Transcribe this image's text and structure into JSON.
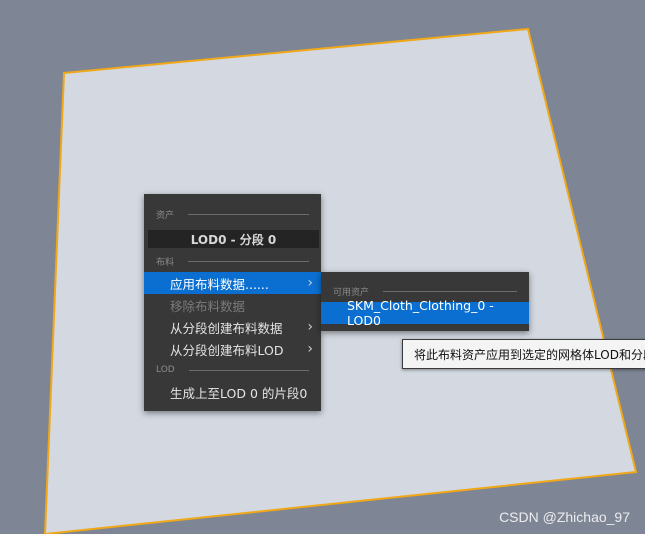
{
  "scene": {
    "background_color": "#7e8594",
    "plane_color": "#d3d8e1",
    "selection_outline_color": "#f0a818"
  },
  "context_menu": {
    "asset_section_header": "资产",
    "title": "LOD0 - 分段 0",
    "cloth_section_header": "布料",
    "items": [
      {
        "label": "应用布料数据......",
        "state": "active",
        "has_submenu": true
      },
      {
        "label": "移除布料数据",
        "state": "disabled",
        "has_submenu": false
      },
      {
        "label": "从分段创建布料数据",
        "state": "normal",
        "has_submenu": true
      },
      {
        "label": "从分段创建布料LOD",
        "state": "normal",
        "has_submenu": true
      }
    ],
    "lod_section_header": "LOD",
    "lod_item": {
      "label": "生成上至LOD 0 的片段0",
      "state": "normal"
    }
  },
  "submenu": {
    "section_header": "可用资产",
    "item": {
      "label": "SKM_Cloth_Clothing_0 - LOD0",
      "state": "active"
    }
  },
  "tooltip": {
    "text": "将此布料资产应用到选定的网格体LOD和分段"
  },
  "watermark": {
    "text": "CSDN @Zhichao_97"
  },
  "colors": {
    "menu_bg": "#383838",
    "highlight": "#0a6fd0",
    "disabled_text": "#7b7b7b"
  }
}
